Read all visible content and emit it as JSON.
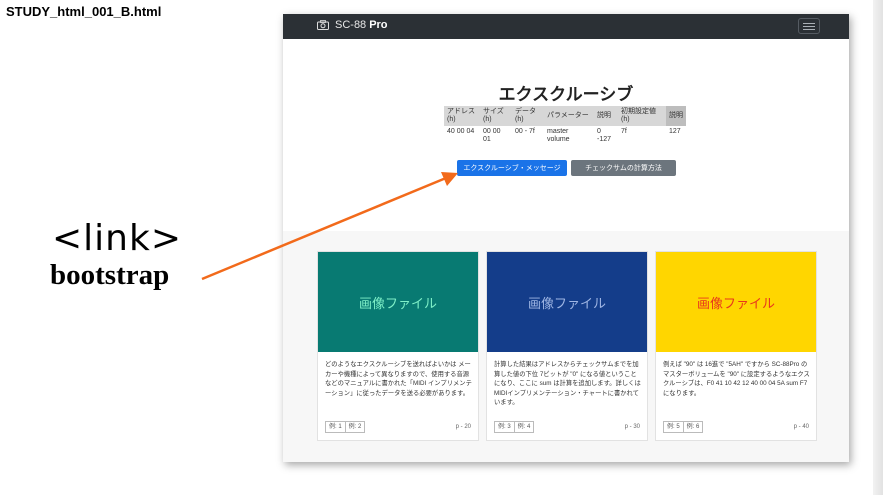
{
  "file_title": "STUDY_html_001_B.html",
  "navbar": {
    "brand_text": "SC-88",
    "brand_bold": "Pro",
    "camera_icon": "camera-icon",
    "toggler_icon": "hamburger-icon"
  },
  "hero": {
    "title": "エクスクルーシブ",
    "table": {
      "headers": [
        "アドレス (h)",
        "サイズ (h)",
        "データ (h)",
        "パラメーター",
        "説明",
        "初期設定値(h)",
        "説明"
      ],
      "row": [
        "40 00 04",
        "00 00 01",
        "00 - 7f",
        "master volume",
        "0 -127",
        "7f",
        "127"
      ]
    },
    "primary_button": "エクスクルーシブ・メッセージ",
    "secondary_button": "チェックサムの計算方法"
  },
  "cards": [
    {
      "thumb_label": "画像ファイル",
      "thumb_bg": "#087a72",
      "thumb_color": "#7ff0c8",
      "text": "どのようなエクスクルーシブを送ればよいかは メーカーや機種によって異なりますので、使用する音源などのマニュアルに書かれた「MIDI インプリメンテーション」に従ったデータを送る必要があります。",
      "btn1": "例: 1",
      "btn2": "例: 2",
      "page": "p - 20"
    },
    {
      "thumb_label": "画像ファイル",
      "thumb_bg": "#143d8a",
      "thumb_color": "#9fb6e4",
      "text": "計算した結果はアドレスからチェックサムまでを加算した値の下位 7ビットが \"0\" になる値ということになり、ここに sum は計算を追加します。詳しくはMIDIインプリメンテーション・チャートに書かれています。",
      "btn1": "例: 3",
      "btn2": "例: 4",
      "page": "p - 30"
    },
    {
      "thumb_label": "画像ファイル",
      "thumb_bg": "#ffd600",
      "thumb_color": "#e8361c",
      "text": "例えば \"90\" は 16進で \"5AH\" ですから SC-88Pro のマスターボリュームを \"90\" に設定するようなエクスクルーシブは、F0 41 10 42 12 40 00 04 5A sum F7 になります。",
      "btn1": "例: 5",
      "btn2": "例: 6",
      "page": "p - 40"
    }
  ],
  "annotation": {
    "tag": "<link>",
    "word": "bootstrap",
    "arrow_color": "#f26a1b"
  }
}
